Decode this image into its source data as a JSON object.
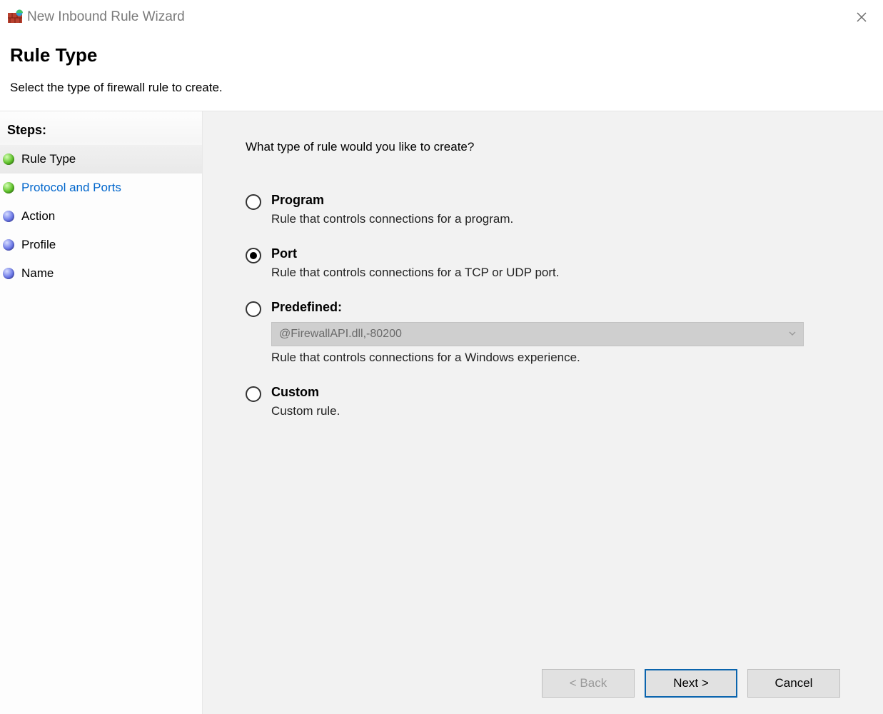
{
  "window": {
    "title": "New Inbound Rule Wizard"
  },
  "header": {
    "title": "Rule Type",
    "subtitle": "Select the type of firewall rule to create."
  },
  "sidebar": {
    "steps_label": "Steps:",
    "items": [
      {
        "label": "Rule Type",
        "state": "current",
        "bullet": "green"
      },
      {
        "label": "Protocol and Ports",
        "state": "link",
        "bullet": "green"
      },
      {
        "label": "Action",
        "state": "pending",
        "bullet": "blue"
      },
      {
        "label": "Profile",
        "state": "pending",
        "bullet": "blue"
      },
      {
        "label": "Name",
        "state": "pending",
        "bullet": "blue"
      }
    ]
  },
  "main": {
    "prompt": "What type of rule would you like to create?",
    "options": [
      {
        "id": "program",
        "title": "Program",
        "desc": "Rule that controls connections for a program.",
        "checked": false
      },
      {
        "id": "port",
        "title": "Port",
        "desc": "Rule that controls connections for a TCP or UDP port.",
        "checked": true
      },
      {
        "id": "predefined",
        "title": "Predefined:",
        "desc": "Rule that controls connections for a Windows experience.",
        "checked": false,
        "combo_value": "@FirewallAPI.dll,-80200",
        "combo_enabled": false
      },
      {
        "id": "custom",
        "title": "Custom",
        "desc": "Custom rule.",
        "checked": false
      }
    ]
  },
  "footer": {
    "back": "< Back",
    "next": "Next >",
    "cancel": "Cancel",
    "back_enabled": false
  }
}
